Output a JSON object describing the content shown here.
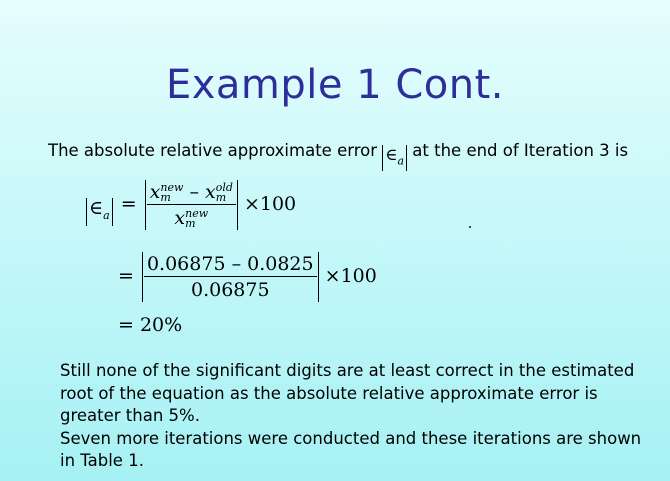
{
  "slide": {
    "title": "Example 1 Cont.",
    "intro_before": "The absolute relative approximate error ",
    "intro_after": " at the end of Iteration 3 is",
    "epsilon_symbol": "∈",
    "epsilon_sub": "a",
    "eq1": {
      "x": "x",
      "sub_m": "m",
      "sup_new": "new",
      "sup_old": "old",
      "minus": "–",
      "times100": "×100"
    },
    "eq2": {
      "numerator": "0.06875 – 0.0825",
      "denominator": "0.06875",
      "times100": "×100"
    },
    "eq3": {
      "result": "= 20%"
    },
    "equals": "=",
    "para1": "Still none of the significant digits are at least correct in the estimated root of the equation as the absolute relative approximate error is greater than 5%.",
    "para2": "Seven more iterations were conducted and these iterations are shown in Table 1."
  }
}
